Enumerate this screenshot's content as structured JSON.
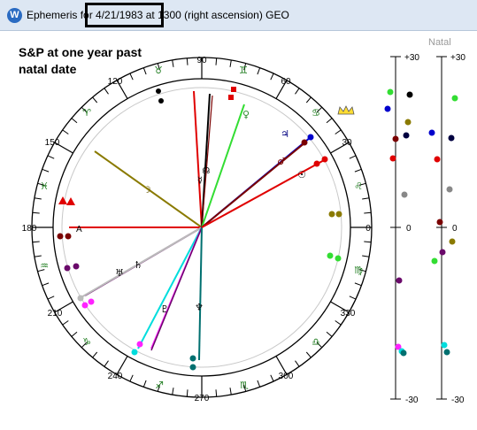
{
  "window": {
    "title_before": "Ephemeris for ",
    "title_date": "4/21/1983",
    "title_after": " at 1300 (right ascension) GEO"
  },
  "caption": "S&P at one year past natal date",
  "natal_label": "Natal",
  "wheel": {
    "degree_labels": [
      "90",
      "60",
      "30",
      "0",
      "330",
      "300",
      "270",
      "240",
      "210",
      "180",
      "150",
      "120"
    ],
    "sign_glyphs": [
      "♉",
      "♊",
      "♋",
      "♌",
      "♍",
      "♎",
      "♏",
      "♐",
      "♑",
      "♒",
      "♓",
      "♈"
    ],
    "planet_glyphs": [
      "♀",
      "♃",
      "♂",
      "☊",
      "☿",
      "☽",
      "♄",
      "♅",
      "♇",
      "♆",
      "☉"
    ],
    "angle_label": "A"
  },
  "scales": {
    "left": {
      "top": "+30",
      "zero": "0",
      "bottom": "-30"
    },
    "right": {
      "top": "+30",
      "zero": "0",
      "bottom": "-30"
    }
  },
  "colors": {
    "red": "#e00000",
    "maroon": "#7a0000",
    "green": "#33dd33",
    "blue": "#0000cc",
    "olive": "#8a7a00",
    "navy": "#000040",
    "magenta": "#ff22ff",
    "purple": "#6a0a6a",
    "teal": "#007070",
    "cyan": "#00dddd",
    "silver": "#bbbbbb",
    "gray": "#888888"
  }
}
